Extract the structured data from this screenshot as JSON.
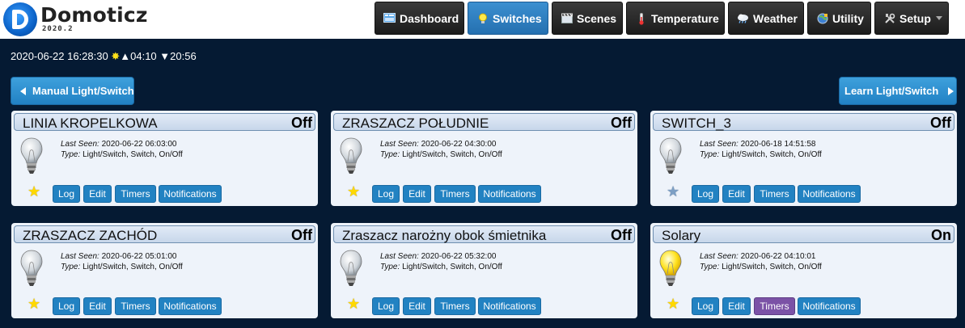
{
  "app": {
    "brand": "Domoticz",
    "version": "2020.2"
  },
  "nav": [
    {
      "label": "Dashboard",
      "icon": "dashboard-icon",
      "active": false
    },
    {
      "label": "Switches",
      "icon": "lightbulb-icon",
      "active": true
    },
    {
      "label": "Scenes",
      "icon": "clapper-icon",
      "active": false
    },
    {
      "label": "Temperature",
      "icon": "thermometer-icon",
      "active": false
    },
    {
      "label": "Weather",
      "icon": "weather-cloud-icon",
      "active": false
    },
    {
      "label": "Utility",
      "icon": "utility-globe-icon",
      "active": false
    },
    {
      "label": "Setup",
      "icon": "tools-icon",
      "active": false
    }
  ],
  "status_bar": {
    "datetime": "2020-06-22 16:28:30",
    "sunrise": "04:10",
    "sunset": "20:56"
  },
  "buttons": {
    "manual": "Manual Light/Switch",
    "learn": "Learn Light/Switch"
  },
  "labels": {
    "last_seen": "Last Seen:",
    "type": "Type:",
    "log": "Log",
    "edit": "Edit",
    "timers": "Timers",
    "notifications": "Notifications"
  },
  "devices": [
    {
      "name": "LINIA KROPELKOWA",
      "status": "Off",
      "last_seen": "2020-06-22 06:03:00",
      "type": "Light/Switch, Switch, On/Off",
      "favorite": true,
      "timers_active": false,
      "bulb_on": false
    },
    {
      "name": "ZRASZACZ POŁUDNIE",
      "status": "Off",
      "last_seen": "2020-06-22 04:30:00",
      "type": "Light/Switch, Switch, On/Off",
      "favorite": true,
      "timers_active": false,
      "bulb_on": false
    },
    {
      "name": "SWITCH_3",
      "status": "Off",
      "last_seen": "2020-06-18 14:51:58",
      "type": "Light/Switch, Switch, On/Off",
      "favorite": false,
      "timers_active": false,
      "bulb_on": false
    },
    {
      "name": "ZRASZACZ ZACHÓD",
      "status": "Off",
      "last_seen": "2020-06-22 05:01:00",
      "type": "Light/Switch, Switch, On/Off",
      "favorite": true,
      "timers_active": false,
      "bulb_on": false
    },
    {
      "name": "Zraszacz narożny obok śmietnika",
      "status": "Off",
      "last_seen": "2020-06-22 05:32:00",
      "type": "Light/Switch, Switch, On/Off",
      "favorite": true,
      "timers_active": false,
      "bulb_on": false
    },
    {
      "name": "Solary",
      "status": "On",
      "last_seen": "2020-06-22 04:10:01",
      "type": "Light/Switch, Switch, On/Off",
      "favorite": true,
      "timers_active": true,
      "bulb_on": true
    }
  ],
  "colors": {
    "background": "#051a33",
    "accent_blue": "#2282c2",
    "timers_active": "#7b52a6",
    "star_favorite": "#ffd900",
    "bulb_on": "#ffe21f"
  }
}
